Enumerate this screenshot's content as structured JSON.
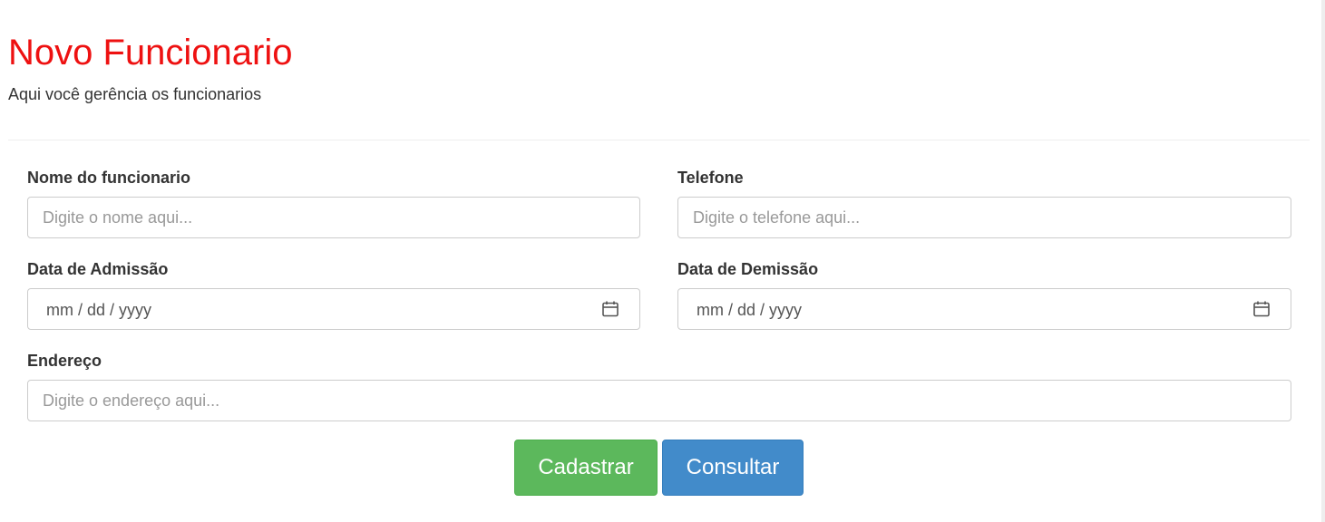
{
  "header": {
    "title": "Novo Funcionario",
    "subtitle": "Aqui você gerência os funcionarios"
  },
  "form": {
    "nome": {
      "label": "Nome do funcionario",
      "value": "",
      "placeholder": "Digite o nome aqui..."
    },
    "telefone": {
      "label": "Telefone",
      "value": "",
      "placeholder": "Digite o telefone aqui..."
    },
    "admissao": {
      "label": "Data de Admissão",
      "value": "mm / dd / yyyy",
      "icon": "calendar-icon"
    },
    "demissao": {
      "label": "Data de Demissão",
      "value": "mm / dd / yyyy",
      "icon": "calendar-icon"
    },
    "endereco": {
      "label": "Endereço",
      "value": "",
      "placeholder": "Digite o endereço aqui..."
    }
  },
  "actions": {
    "cadastrar_label": "Cadastrar",
    "consultar_label": "Consultar"
  },
  "colors": {
    "title": "#ee1111",
    "success": "#5cb85c",
    "primary": "#428bca"
  }
}
